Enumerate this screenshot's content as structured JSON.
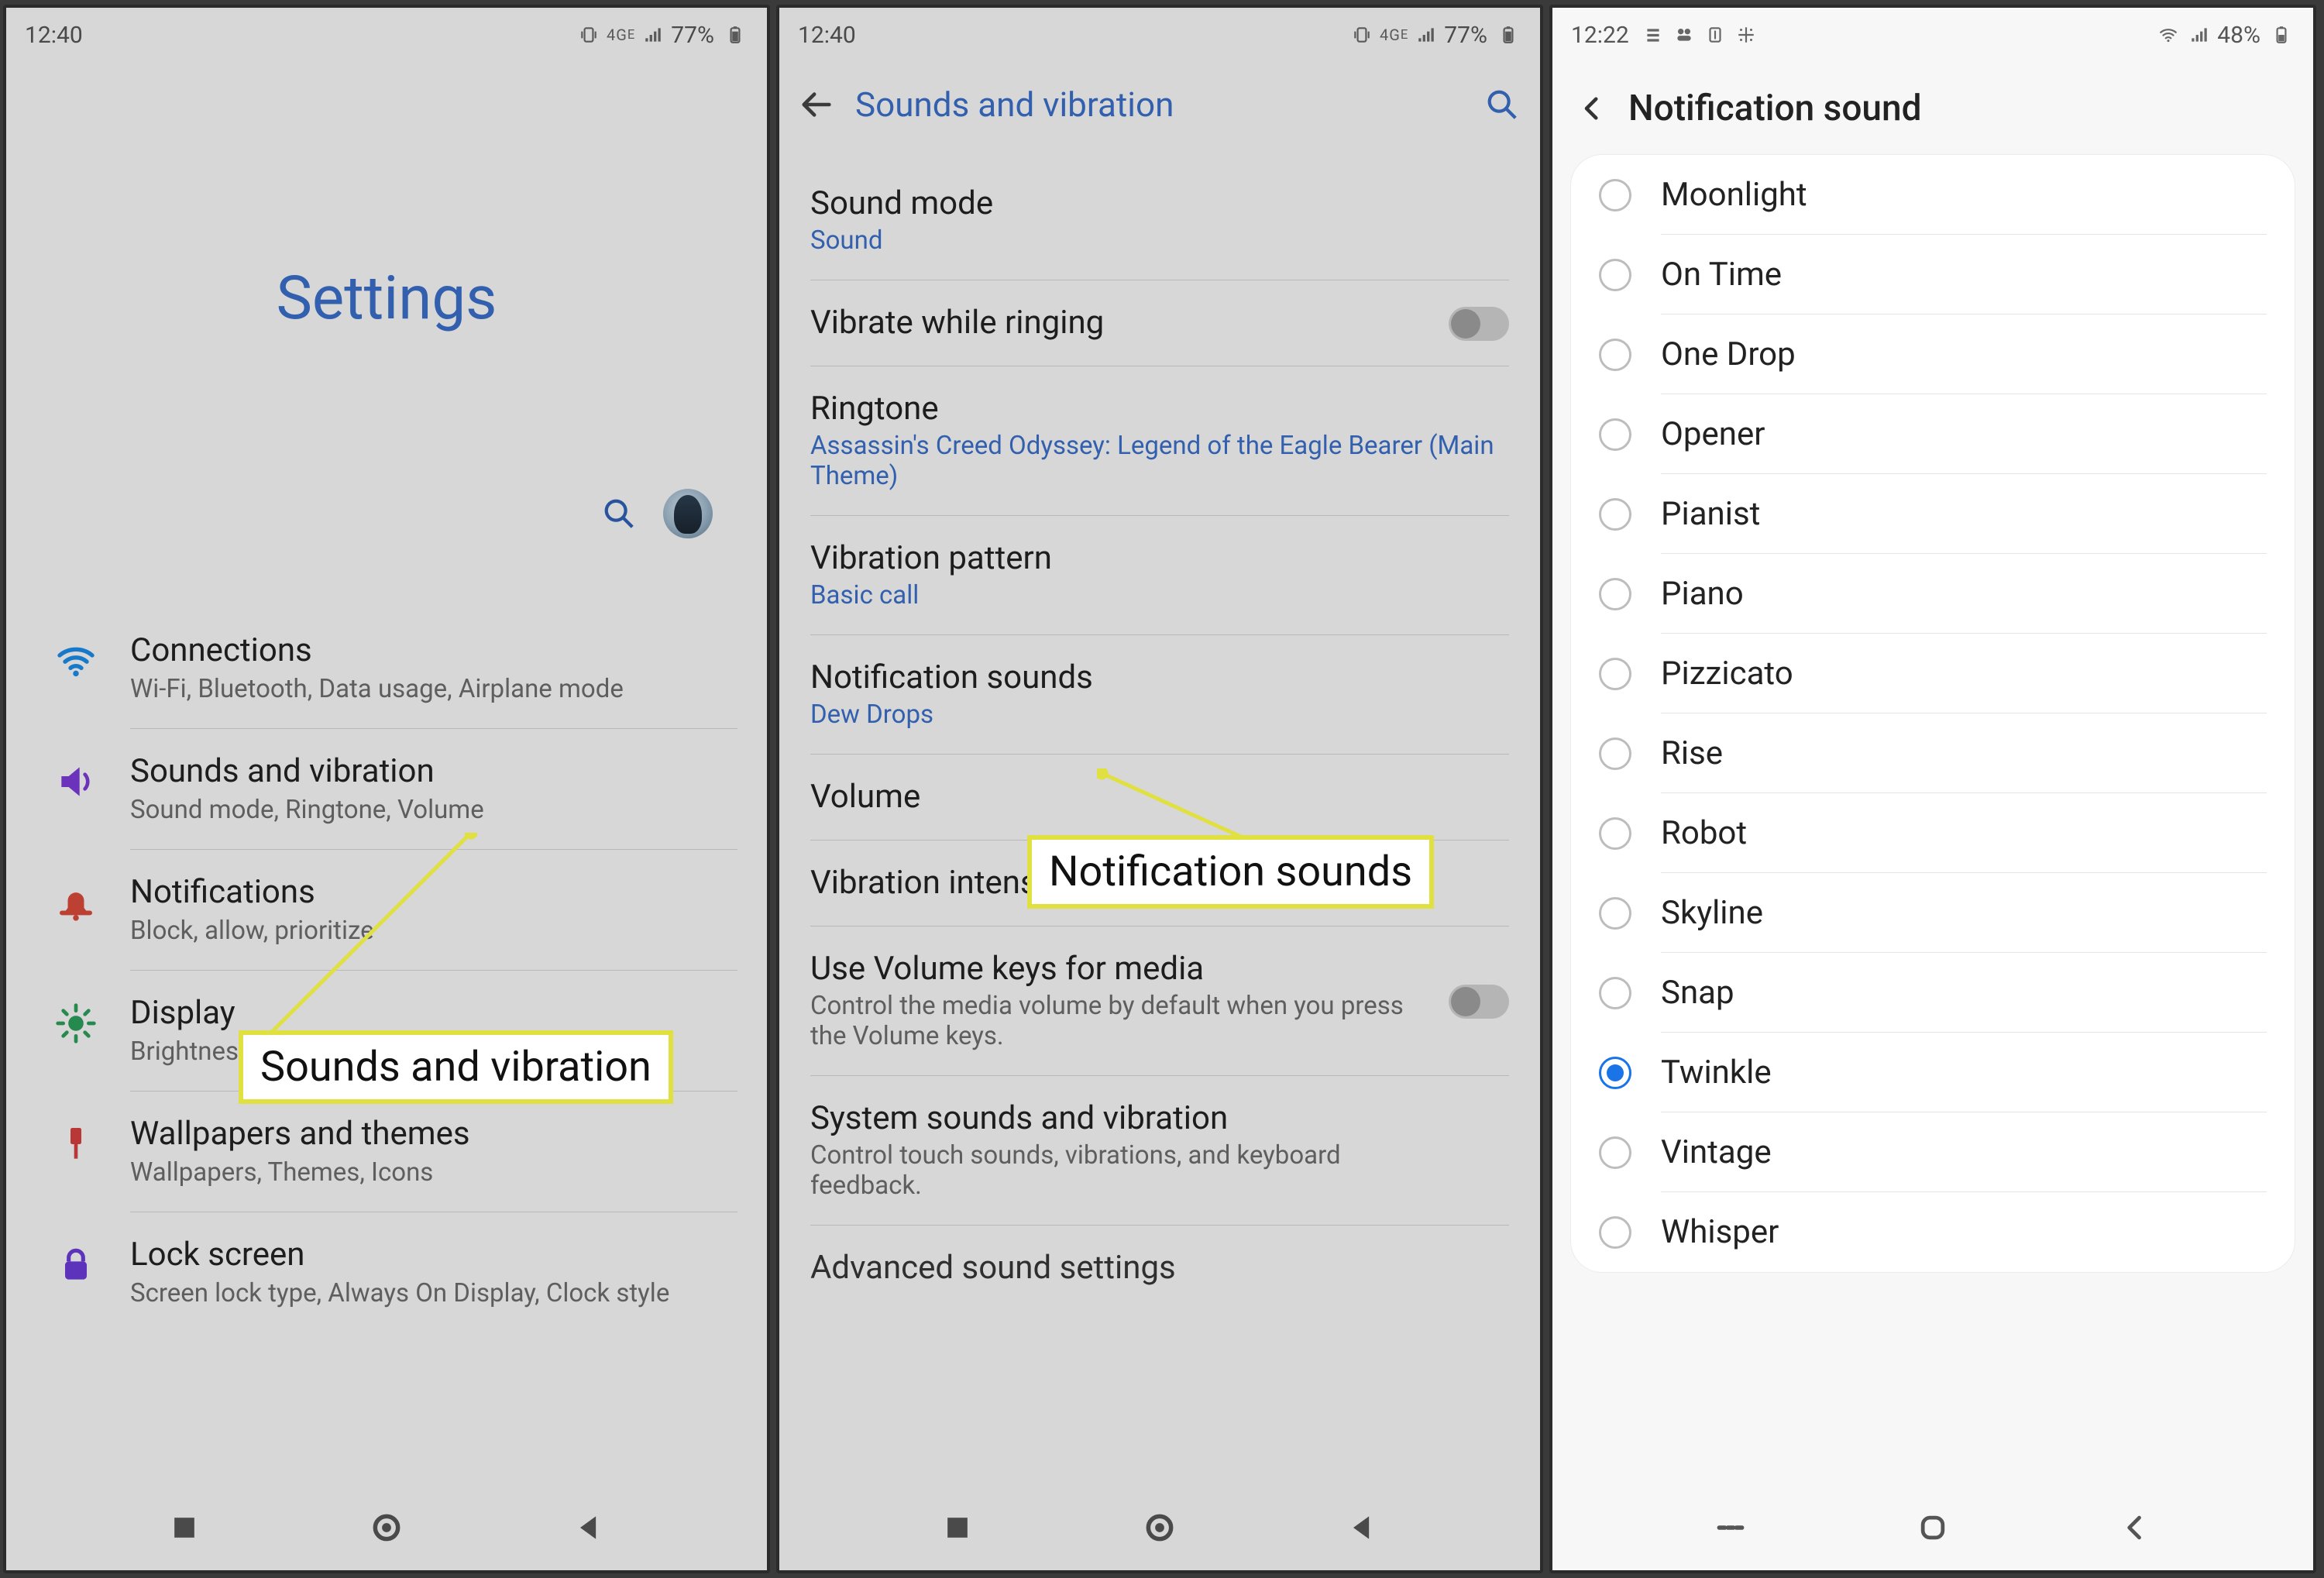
{
  "phoneA": {
    "status": {
      "time": "12:40",
      "battery": "77%"
    },
    "title": "Settings",
    "items": [
      {
        "icon": "wifi",
        "color": "#1b8ae6",
        "title": "Connections",
        "sub": "Wi-Fi, Bluetooth, Data usage, Airplane mode"
      },
      {
        "icon": "speaker",
        "color": "#7a3bd6",
        "title": "Sounds and vibration",
        "sub": "Sound mode, Ringtone, Volume"
      },
      {
        "icon": "bell",
        "color": "#d64a3a",
        "title": "Notifications",
        "sub": "Block, allow, prioritize"
      },
      {
        "icon": "sun",
        "color": "#2c9c59",
        "title": "Display",
        "sub": "Brightness, Blue light filter, Home screen"
      },
      {
        "icon": "brush",
        "color": "#d43f3f",
        "title": "Wallpapers and themes",
        "sub": "Wallpapers, Themes, Icons"
      },
      {
        "icon": "lock",
        "color": "#6a3bd6",
        "title": "Lock screen",
        "sub": "Screen lock type, Always On Display, Clock style"
      }
    ],
    "callout": "Sounds and vibration"
  },
  "phoneB": {
    "status": {
      "time": "12:40",
      "battery": "77%"
    },
    "title": "Sounds and vibration",
    "items": [
      {
        "kind": "blue",
        "title": "Sound mode",
        "sub": "Sound"
      },
      {
        "kind": "toggle",
        "title": "Vibrate while ringing"
      },
      {
        "kind": "blue",
        "title": "Ringtone",
        "sub": "Assassin's Creed Odyssey: Legend of the Eagle Bearer (Main Theme)"
      },
      {
        "kind": "blue",
        "title": "Vibration pattern",
        "sub": "Basic call"
      },
      {
        "kind": "blue",
        "title": "Notification sounds",
        "sub": "Dew Drops"
      },
      {
        "kind": "plain",
        "title": "Volume"
      },
      {
        "kind": "plain",
        "title": "Vibration intensity"
      },
      {
        "kind": "toggle-sub",
        "title": "Use Volume keys for media",
        "sub": "Control the media volume by default when you press the Volume keys."
      },
      {
        "kind": "gsub",
        "title": "System sounds and vibration",
        "sub": "Control touch sounds, vibrations, and keyboard feedback."
      },
      {
        "kind": "plain",
        "title": "Advanced sound settings"
      }
    ],
    "callout": "Notification sounds"
  },
  "phoneC": {
    "status": {
      "time": "12:22",
      "battery": "48%"
    },
    "title": "Notification sound",
    "selected": "Twinkle",
    "options": [
      "Moonlight",
      "On Time",
      "One Drop",
      "Opener",
      "Pianist",
      "Piano",
      "Pizzicato",
      "Rise",
      "Robot",
      "Skyline",
      "Snap",
      "Twinkle",
      "Vintage",
      "Whisper"
    ]
  },
  "nav": {
    "a": "recent",
    "b": "home",
    "c": "back"
  }
}
